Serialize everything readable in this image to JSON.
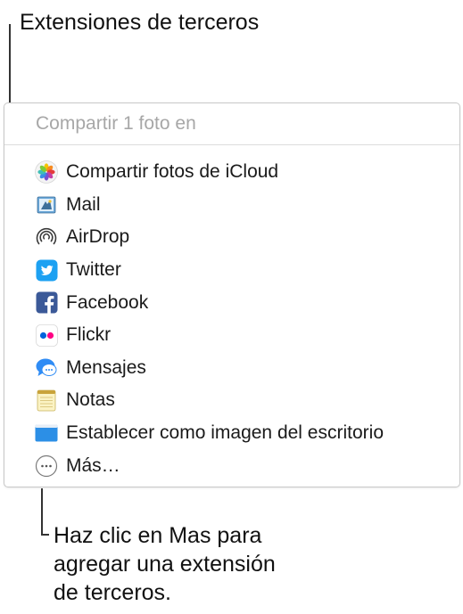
{
  "callouts": {
    "top": "Extensiones de terceros",
    "bottom": "Haz clic en Mas para\nagregar una extensión\nde terceros."
  },
  "panel": {
    "header": "Compartir 1 foto en",
    "items": [
      {
        "label": "Compartir fotos de iCloud",
        "icon": "icloud-photos-icon"
      },
      {
        "label": "Mail",
        "icon": "mail-icon"
      },
      {
        "label": "AirDrop",
        "icon": "airdrop-icon"
      },
      {
        "label": "Twitter",
        "icon": "twitter-icon"
      },
      {
        "label": "Facebook",
        "icon": "facebook-icon"
      },
      {
        "label": "Flickr",
        "icon": "flickr-icon"
      },
      {
        "label": "Mensajes",
        "icon": "messages-icon"
      },
      {
        "label": "Notas",
        "icon": "notes-icon"
      },
      {
        "label": "Establecer como imagen del escritorio",
        "icon": "desktop-picture-icon"
      },
      {
        "label": "Más…",
        "icon": "more-icon"
      }
    ]
  },
  "colors": {
    "twitter": "#1da1f2",
    "facebook": "#3b5998",
    "flickr_blue": "#0063dc",
    "flickr_pink": "#ff0084",
    "messages": "#2f8cf5",
    "desktop": "#2c8fe6",
    "header_text": "#a7a7a7"
  }
}
